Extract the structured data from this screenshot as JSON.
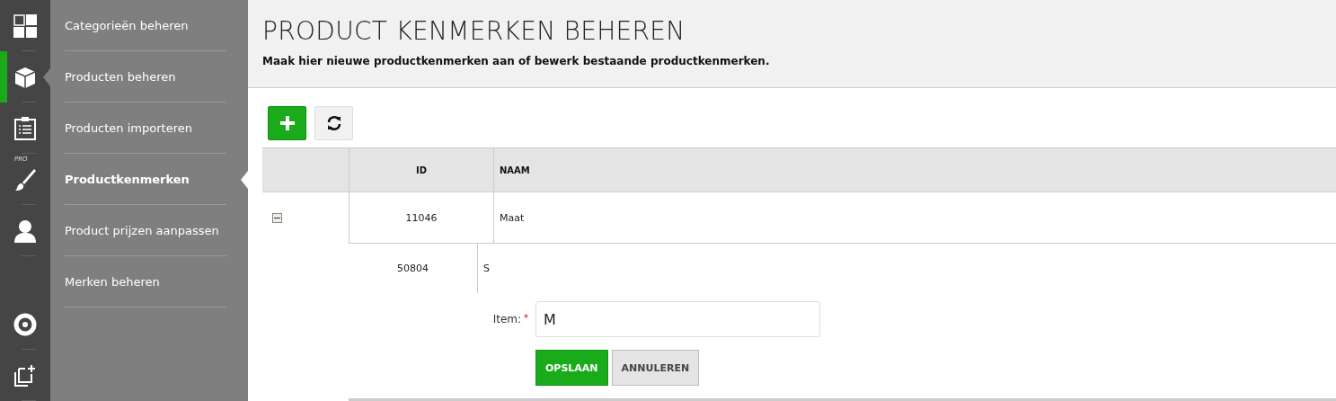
{
  "rail": {
    "items": [
      {
        "selected": false
      },
      {
        "selected": true
      },
      {
        "selected": false
      },
      {
        "selected": false,
        "badge": "PRO"
      },
      {
        "selected": false
      }
    ]
  },
  "submenu": {
    "items": [
      {
        "label": "Categorieën beheren",
        "selected": false
      },
      {
        "label": "Producten beheren",
        "selected": false
      },
      {
        "label": "Producten importeren",
        "selected": false
      },
      {
        "label": "Productkenmerken",
        "selected": true
      },
      {
        "label": "Product prijzen aanpassen",
        "selected": false
      },
      {
        "label": "Merken beheren",
        "selected": false
      }
    ]
  },
  "header": {
    "title": "PRODUCT KENMERKEN BEHEREN",
    "subtitle": "Maak hier nieuwe productkenmerken aan of bewerk bestaande productkenmerken."
  },
  "table": {
    "columns": [
      "ID",
      "NAAM"
    ],
    "rows": [
      {
        "id": "11046",
        "name": "Maat",
        "expanded": true,
        "children": [
          {
            "id": "50804",
            "name": "S"
          }
        ]
      }
    ]
  },
  "form": {
    "label": "Item:",
    "required": true,
    "required_mark": "*",
    "value": "M",
    "buttons": [
      {
        "label": "OPSLAAN",
        "kind": "primary"
      },
      {
        "label": "ANNULEREN",
        "kind": "secondary"
      }
    ]
  }
}
